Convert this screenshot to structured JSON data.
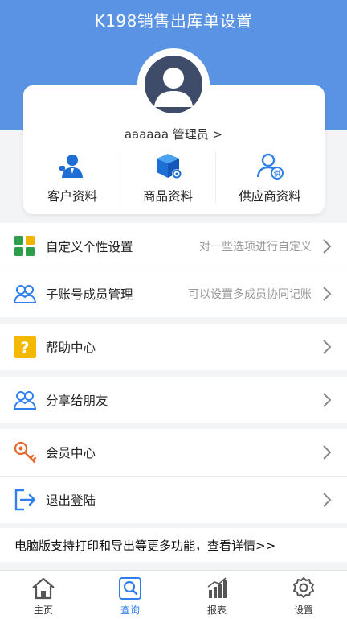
{
  "app": {
    "title": "K198销售出库单设置"
  },
  "user": {
    "line": "aaaaaa 管理员 >"
  },
  "quick_links": [
    {
      "label": "客户资料",
      "icon": "customer-icon"
    },
    {
      "label": "商品资料",
      "icon": "product-box-icon"
    },
    {
      "label": "供应商资料",
      "icon": "supplier-icon"
    }
  ],
  "menu": {
    "custom": {
      "label": "自定义个性设置",
      "hint": "对一些选项进行自定义",
      "icon": "grid-icon"
    },
    "members": {
      "label": "子账号成员管理",
      "hint": "可以设置多成员协同记账",
      "icon": "users-icon"
    },
    "help": {
      "label": "帮助中心",
      "icon": "question-icon"
    },
    "share": {
      "label": "分享给朋友",
      "icon": "share-users-icon"
    },
    "vip": {
      "label": "会员中心",
      "icon": "key-icon"
    },
    "logout": {
      "label": "退出登陆",
      "icon": "logout-icon"
    }
  },
  "promo": {
    "text": "电脑版支持打印和导出等更多功能，查看详情>>"
  },
  "tabs": [
    {
      "label": "主页",
      "icon": "home-icon"
    },
    {
      "label": "查询",
      "icon": "search-icon",
      "active": true
    },
    {
      "label": "报表",
      "icon": "report-icon"
    },
    {
      "label": "设置",
      "icon": "gear-icon"
    }
  ],
  "colors": {
    "header": "#5a93e4",
    "accent": "#2f80ed",
    "help_yellow": "#f5b800",
    "grid_green": "#2e9e4a",
    "key_orange": "#e26a2c"
  }
}
